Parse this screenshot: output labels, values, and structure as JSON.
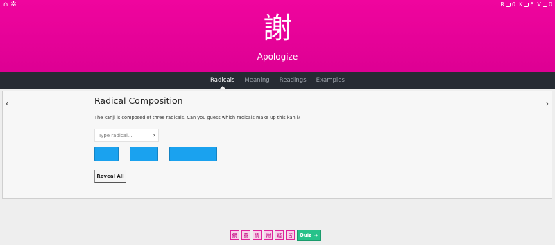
{
  "header": {
    "left_icons": [
      {
        "icon": "home-icon",
        "glyph": "⌂"
      },
      {
        "icon": "gear-icon",
        "glyph": "✲"
      }
    ],
    "stats": [
      {
        "letter": "R",
        "count": "0",
        "icon": "tray-icon"
      },
      {
        "letter": "K",
        "count": "6",
        "icon": "tray-icon"
      },
      {
        "letter": "V",
        "count": "0",
        "icon": "tray-icon"
      }
    ],
    "kanji": "謝",
    "meaning": "Apologize",
    "background_color": "#e6009a"
  },
  "nav": {
    "tabs": [
      {
        "label": "Radicals",
        "active": true
      },
      {
        "label": "Meaning",
        "active": false
      },
      {
        "label": "Readings",
        "active": false
      },
      {
        "label": "Examples",
        "active": false
      }
    ]
  },
  "card": {
    "prev_glyph": "‹",
    "next_glyph": "›",
    "title": "Radical Composition",
    "question": "The kanji is composed of three radicals. Can you guess which radicals make up this kanji?",
    "input_placeholder": "Type radical...",
    "input_value": "",
    "submit_glyph": "›",
    "radical_slot_color": "#1aa2ef",
    "reveal_label": "Reveal All"
  },
  "bottom_bar": {
    "kanji_queue": [
      "鏡",
      "養",
      "情",
      "謝",
      "疑",
      "皆"
    ],
    "quiz_label": "Quiz",
    "quiz_arrow": "→",
    "chip_color": "#f8d3ea",
    "quiz_color": "#27c28a"
  }
}
